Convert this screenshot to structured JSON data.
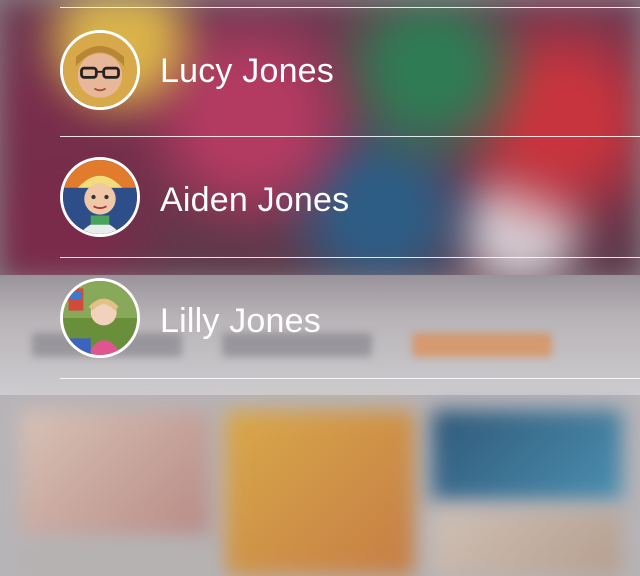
{
  "contacts": [
    {
      "name": "Lucy Jones",
      "avatar_icon": "photo-woman-glasses"
    },
    {
      "name": "Aiden Jones",
      "avatar_icon": "photo-toddler-hat"
    },
    {
      "name": "Lilly Jones",
      "avatar_icon": "photo-baby-grass"
    }
  ],
  "colors": {
    "text": "#ffffff",
    "divider": "#ffffff",
    "accent_blurred": "#e87d2d"
  }
}
